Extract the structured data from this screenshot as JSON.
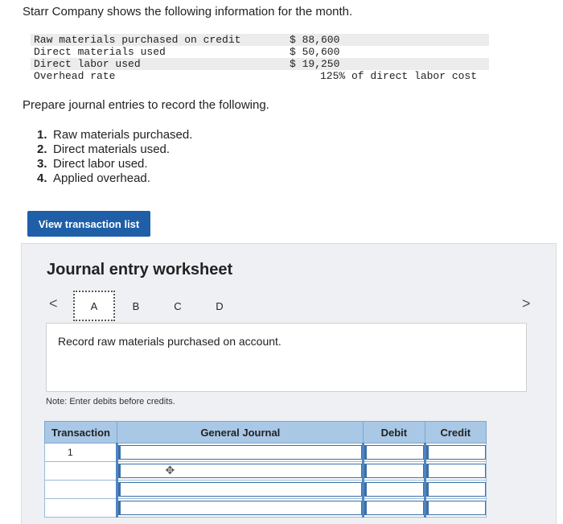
{
  "intro": "Starr Company shows the following information for the month.",
  "info_rows": [
    {
      "label": "Raw materials purchased on credit",
      "value": "$ 88,600"
    },
    {
      "label": "Direct materials used",
      "value": "$ 50,600"
    },
    {
      "label": "Direct labor used",
      "value": "$ 19,250"
    },
    {
      "label": "Overhead rate",
      "value": "125% of direct labor cost"
    }
  ],
  "prepare": "Prepare journal entries to record the following.",
  "tasks": [
    {
      "num": "1.",
      "text": "Raw materials purchased."
    },
    {
      "num": "2.",
      "text": "Direct materials used."
    },
    {
      "num": "3.",
      "text": "Direct labor used."
    },
    {
      "num": "4.",
      "text": "Applied overhead."
    }
  ],
  "view_button": "View transaction list",
  "worksheet": {
    "title": "Journal entry worksheet",
    "prev_icon": "chevron-left-icon",
    "next_icon": "chevron-right-icon",
    "prev_glyph": "<",
    "next_glyph": ">",
    "tabs": [
      "A",
      "B",
      "C",
      "D"
    ],
    "active_tab": "A",
    "instruction": "Record raw materials purchased on account.",
    "note": "Note: Enter debits before credits.",
    "table": {
      "headers": {
        "transaction": "Transaction",
        "general_journal": "General Journal",
        "debit": "Debit",
        "credit": "Credit"
      },
      "rows": [
        {
          "transaction": "1"
        },
        {
          "transaction": ""
        },
        {
          "transaction": ""
        },
        {
          "transaction": ""
        }
      ]
    }
  },
  "colors": {
    "button_blue": "#1f5fa8",
    "header_blue": "#a9c8e6",
    "panel_bg": "#eef0f3"
  }
}
